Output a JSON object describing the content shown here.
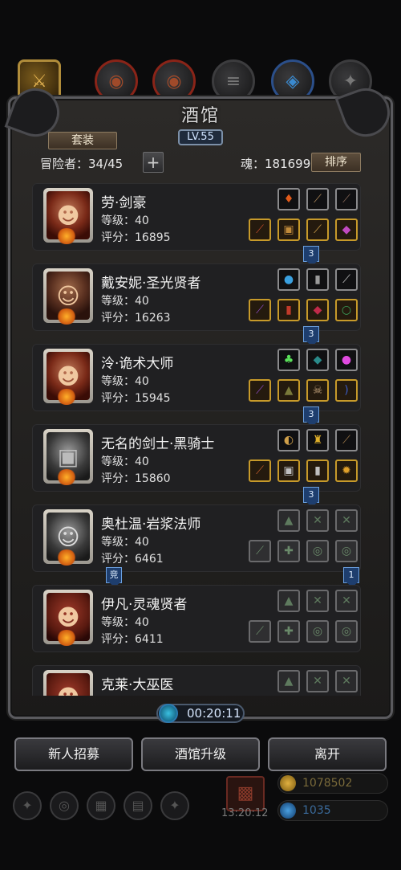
{
  "window": {
    "title": "酒馆",
    "level_badge": "LV.55"
  },
  "header": {
    "suit_button": "套装",
    "adventurers_label": "冒险者：34/45",
    "plus_button": "+",
    "soul_label": "魂：181699",
    "sort_button": "排序"
  },
  "heroes": [
    {
      "name": "劳·剑豪",
      "level": "等级：40",
      "score": "评分：16895",
      "top_slots": [
        "fire-gem",
        "crossbow-icon",
        "boot-icon"
      ],
      "bottom_slots": [
        "sword-icon",
        "armor-icon",
        "staff-icon",
        "potion-icon"
      ]
    },
    {
      "name": "戴安妮·圣光贤者",
      "level": "等级：40",
      "score": "评分：16263",
      "top_slots": [
        "orb-icon",
        "shield-icon",
        "dagger-icon"
      ],
      "bottom_slots": [
        "wand-icon",
        "robe-icon",
        "gem-icon",
        "ring-icon"
      ]
    },
    {
      "name": "泠·诡术大师",
      "level": "等级：40",
      "score": "评分：15945",
      "top_slots": [
        "poison-icon",
        "cloak-icon",
        "magic-orb-icon"
      ],
      "bottom_slots": [
        "spear-icon",
        "hood-icon",
        "skull-icon",
        "bow-icon"
      ]
    },
    {
      "name": "无名的剑士·黑骑士",
      "level": "等级：40",
      "score": "评分：15860",
      "top_slots": [
        "mask-icon",
        "lantern-icon",
        "sickle-icon"
      ],
      "bottom_slots": [
        "mace-icon",
        "armor-icon",
        "cape-icon",
        "spark-icon"
      ]
    },
    {
      "name": "奥杜温·岩浆法师",
      "level": "等级：40",
      "score": "评分：6461",
      "top_slots": [
        "empty-slot",
        "empty-slot",
        "empty-slot"
      ],
      "bottom_slots": [
        "empty-slot",
        "empty-slot",
        "empty-slot",
        "empty-slot"
      ]
    },
    {
      "name": "伊凡·灵魂贤者",
      "level": "等级：40",
      "score": "评分：6411",
      "top_slots": [
        "empty-slot",
        "empty-slot",
        "empty-slot"
      ],
      "bottom_slots": [
        "empty-slot",
        "empty-slot",
        "empty-slot",
        "empty-slot"
      ]
    },
    {
      "name": "克莱·大巫医",
      "level": "",
      "score": "",
      "top_slots": [
        "empty-slot",
        "empty-slot",
        "empty-slot"
      ],
      "bottom_slots": []
    }
  ],
  "connectors": [
    "3",
    "3",
    "3",
    "3",
    "竞",
    "1"
  ],
  "timer": "00:20:11",
  "actions": {
    "recruit": "新人招募",
    "upgrade": "酒馆升级",
    "leave": "离开"
  },
  "footer": {
    "timer2": "13:20:12",
    "gold": "1078502",
    "gems": "1035"
  },
  "colors": {
    "accent_gold": "#c79a2a",
    "connector_blue": "#1e3e6e",
    "panel": "#2c2a28"
  }
}
